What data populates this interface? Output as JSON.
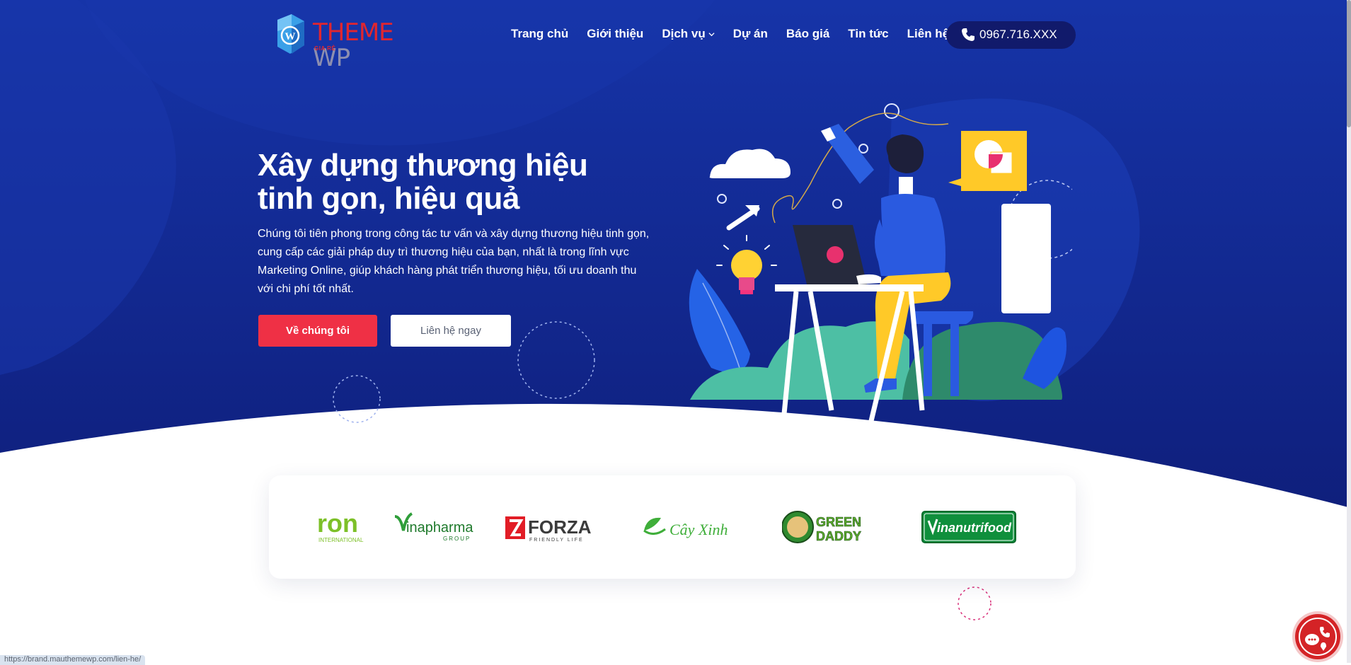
{
  "brand": {
    "name_part1": "THEME",
    "name_part2": "WP",
    "tagline": "GIA RẺ"
  },
  "nav": {
    "items": [
      {
        "label": "Trang chủ"
      },
      {
        "label": "Giới thiệu"
      },
      {
        "label": "Dịch vụ"
      },
      {
        "label": "Dự án"
      },
      {
        "label": "Báo giá"
      },
      {
        "label": "Tin tức"
      },
      {
        "label": "Liên hệ"
      }
    ],
    "phone": "0967.716.XXX"
  },
  "hero": {
    "title_line1": "Xây dựng thương hiệu",
    "title_line2": "tinh gọn, hiệu quả",
    "description": "Chúng tôi tiên phong trong công tác tư vấn và xây dựng thương hiệu tinh gọn, cung cấp các giải pháp duy trì thương hiệu của bạn, nhất là trong lĩnh vực Marketing Online, giúp khách hàng phát triển thương hiệu, tối ưu doanh thu với chi phí tốt nhất.",
    "primary_button": "Về chúng tôi",
    "secondary_button": "Liên hệ ngay"
  },
  "partners": {
    "ron_main": "ron",
    "ron_sub": "INTERNATIONAL",
    "vinapharma_main": "inapharma",
    "vinapharma_sub": "GROUP",
    "forza_main": "FORZA",
    "forza_sub": "FRIENDLY LIFE",
    "cayxinh": "Cây Xinh",
    "greendaddy_1": "GREEN",
    "greendaddy_2": "DADDY",
    "vinanutrifood": "inanutrifood"
  },
  "status_url": "https://brand.mauthemewp.com/lien-he/",
  "colors": {
    "hero_bg": "#14289a",
    "accent_red": "#ef3045",
    "phone_pill": "#111a6b"
  },
  "icons": [
    "wordpress-logo-icon",
    "chevron-down-icon",
    "phone-icon",
    "chat-icon",
    "map-pin-icon"
  ]
}
